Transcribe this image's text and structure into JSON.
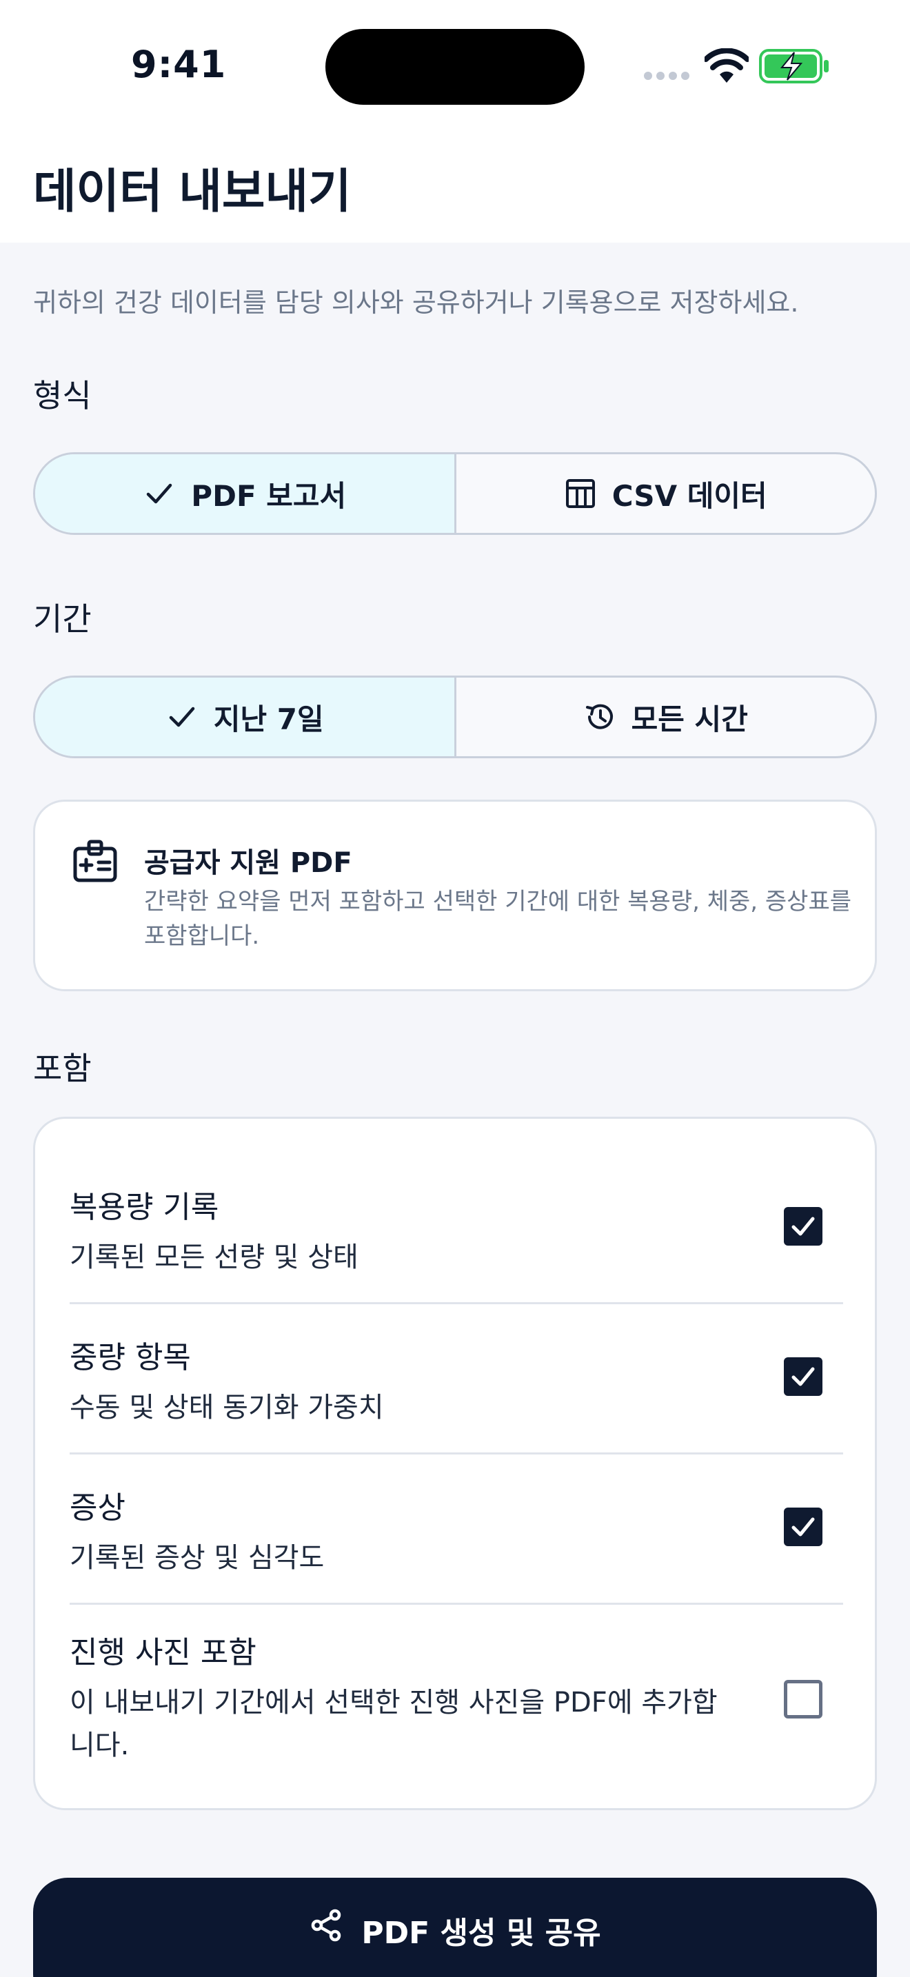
{
  "status_bar": {
    "time": "9:41"
  },
  "header": {
    "title": "데이터 내보내기"
  },
  "intro": "귀하의 건강 데이터를 담당 의사와 공유하거나 기록용으로 저장하세요.",
  "format": {
    "label": "형식",
    "options": [
      {
        "label": "PDF 보고서",
        "icon": "check-icon",
        "selected": true
      },
      {
        "label": "CSV 데이터",
        "icon": "table-icon",
        "selected": false
      }
    ]
  },
  "period": {
    "label": "기간",
    "options": [
      {
        "label": "지난 7일",
        "icon": "check-icon",
        "selected": true
      },
      {
        "label": "모든 시간",
        "icon": "history-icon",
        "selected": false
      }
    ]
  },
  "info_card": {
    "icon": "medical-id-icon",
    "title": "공급자 지원 PDF",
    "description": "간략한 요약을 먼저 포함하고 선택한 기간에 대한 복용량, 체중, 증상표를 포함합니다."
  },
  "include": {
    "label": "포함",
    "items": [
      {
        "title": "복용량 기록",
        "description": "기록된 모든 선량 및 상태",
        "checked": true
      },
      {
        "title": "중량 항목",
        "description": "수동 및 상태 동기화 가중치",
        "checked": true
      },
      {
        "title": "증상",
        "description": "기록된 증상 및 심각도",
        "checked": true
      },
      {
        "title": "진행 사진 포함",
        "description": "이 내보내기 기간에서 선택한 진행 사진을 PDF에 추가합니다.",
        "checked": false
      }
    ]
  },
  "primary_action": {
    "label": "PDF 생성 및 공유",
    "icon": "share-icon"
  },
  "colors": {
    "selected_segment": "#e7f9fd",
    "primary": "#0c1730",
    "battery": "#34c759"
  }
}
